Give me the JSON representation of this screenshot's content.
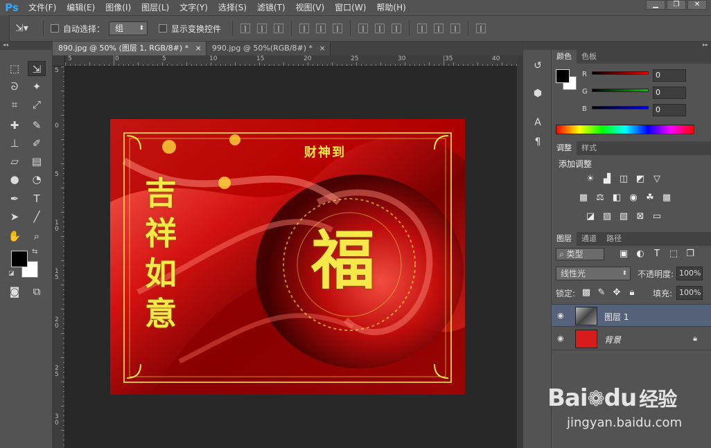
{
  "app": {
    "logo": "Ps"
  },
  "menu": [
    "文件(F)",
    "编辑(E)",
    "图像(I)",
    "图层(L)",
    "文字(Y)",
    "选择(S)",
    "滤镜(T)",
    "视图(V)",
    "窗口(W)",
    "帮助(H)"
  ],
  "window_controls": [
    "▁",
    "❐",
    "✕"
  ],
  "options": {
    "auto_select_label": "自动选择：",
    "auto_select_value": "组",
    "show_transform_label": "显示变换控件"
  },
  "tabs": [
    {
      "label": "890.jpg @ 50% (图层 1, RGB/8#) *",
      "close": "×"
    },
    {
      "label": "990.jpg @ 50%(RGB/8#) *",
      "close": "×"
    }
  ],
  "ruler_h_labels": [
    "5",
    "0",
    "5",
    "10",
    "15",
    "20",
    "25",
    "30",
    "35",
    "40"
  ],
  "ruler_v_labels": [
    "5",
    "0",
    "5",
    "1 0",
    "1 5",
    "2 0",
    "2 5",
    "3 0"
  ],
  "image_text": {
    "left_chars": [
      "吉",
      "祥",
      "如",
      "意"
    ],
    "center_char": "福",
    "top_banner": "财神到"
  },
  "color_panel": {
    "tabs": [
      "颜色",
      "色板"
    ],
    "channels": [
      {
        "label": "R",
        "value": "0",
        "color": "#d40000"
      },
      {
        "label": "G",
        "value": "0",
        "color": "#00b000"
      },
      {
        "label": "B",
        "value": "0",
        "color": "#0000d0"
      }
    ]
  },
  "adjust_panel": {
    "tabs": [
      "调整",
      "样式"
    ],
    "title": "添加调整"
  },
  "layers_panel": {
    "tabs": [
      "图层",
      "通道",
      "路径"
    ],
    "filter_kind": "类型",
    "blend_mode": "线性光",
    "opacity_label": "不透明度:",
    "opacity_value": "100%",
    "lock_label": "锁定:",
    "fill_label": "填充:",
    "fill_value": "100%",
    "layers": [
      {
        "name": "图层 1",
        "selected": true
      },
      {
        "name": "背景",
        "selected": false
      }
    ]
  },
  "watermark": {
    "brand_a": "Bai",
    "brand_b": "du",
    "brand_c": "经验",
    "url": "jingyan.baidu.com"
  },
  "colors": {
    "accent": "#31a8ff",
    "selected_layer": "#56627a",
    "gold": "#f7e84a"
  }
}
